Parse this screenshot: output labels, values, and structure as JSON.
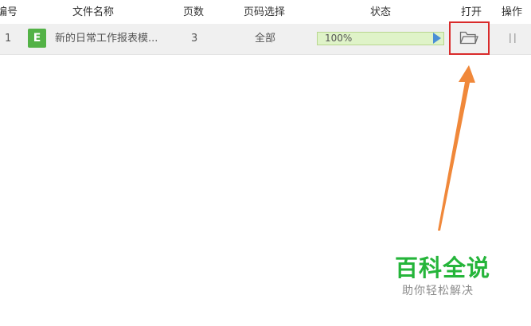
{
  "table": {
    "columns": {
      "number": "编号",
      "filename": "文件名称",
      "pages": "页数",
      "page_range": "页码选择",
      "status": "状态",
      "open": "打开",
      "action": "操作"
    },
    "rows": [
      {
        "number": "1",
        "file_type_badge": "E",
        "filename": "新的日常工作报表模...",
        "pages": "3",
        "page_range": "全部",
        "progress_percent": 100,
        "progress_label": "100%",
        "open_icon": "folder-icon",
        "action_icon": "pause-icon"
      }
    ]
  },
  "colors": {
    "highlight_border": "#d92b2b",
    "arrow": "#f0883a",
    "badge": "#53b246",
    "progress_fill": "#dff3c8",
    "watermark_title": "#25b53a"
  },
  "watermark": {
    "title": "百科全说",
    "subtitle": "助你轻松解决"
  }
}
